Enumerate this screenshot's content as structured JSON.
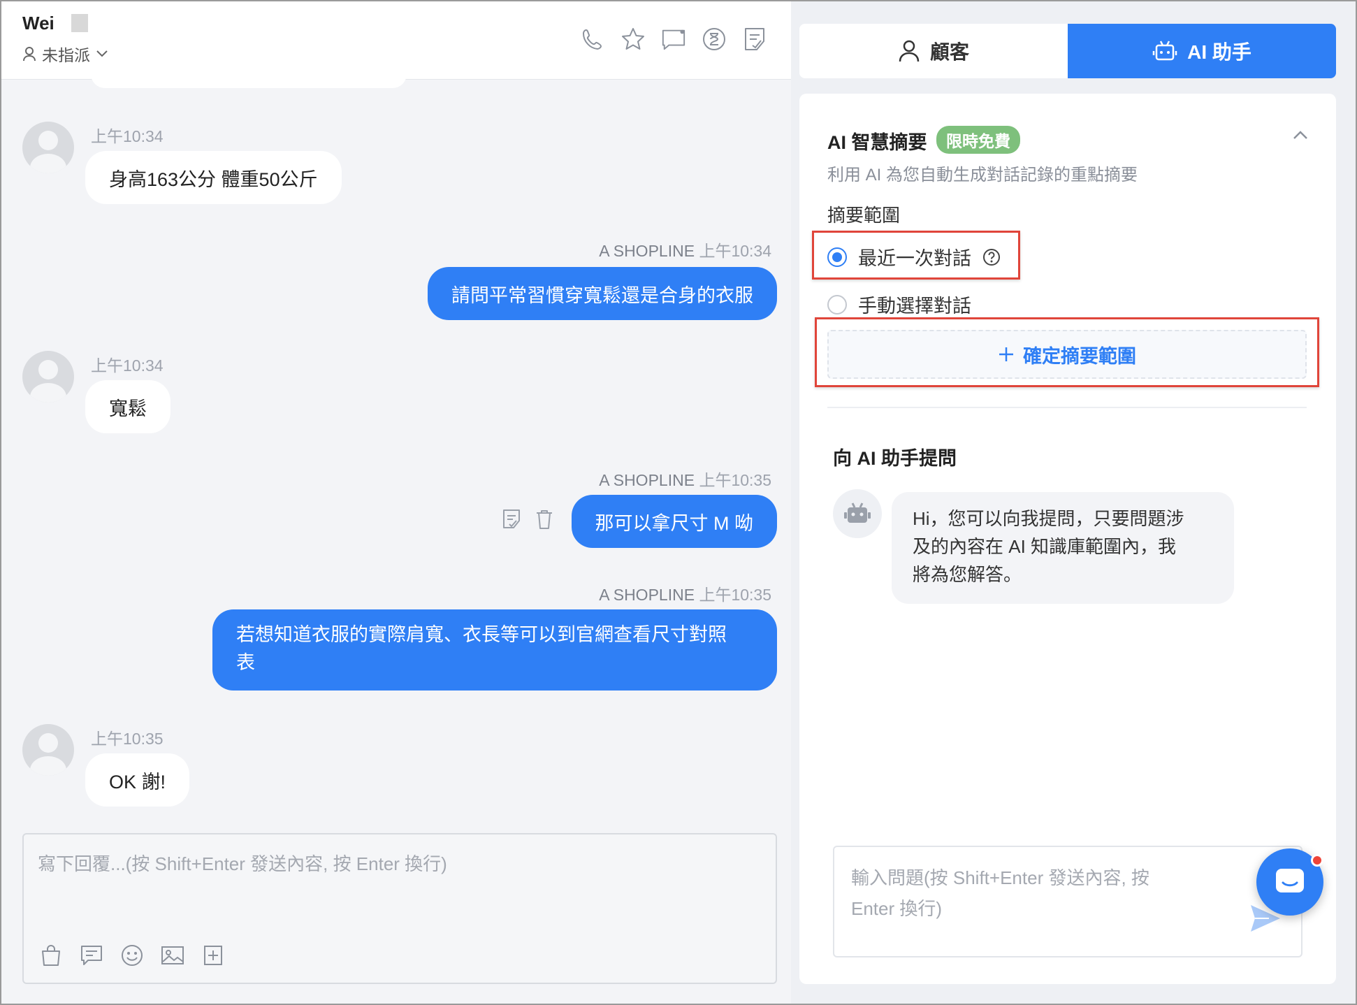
{
  "header": {
    "contact_name": "Wei",
    "assign_label": "未指派",
    "icons": [
      "phone-icon",
      "star-icon",
      "message-icon",
      "timer-icon",
      "note-icon"
    ]
  },
  "messages": [
    {
      "side": "in",
      "time": "上午10:34",
      "text": "身高163公分 體重50公斤"
    },
    {
      "side": "out",
      "agent": "A SHOPLINE",
      "time": "上午10:34",
      "text": "請問平常習慣穿寬鬆還是合身的衣服"
    },
    {
      "side": "in",
      "time": "上午10:34",
      "text": "寬鬆"
    },
    {
      "side": "out",
      "agent": "A SHOPLINE",
      "time": "上午10:35",
      "text": "那可以拿尺寸 M 呦"
    },
    {
      "side": "out",
      "agent": "A SHOPLINE",
      "time": "上午10:35",
      "text_line1": "若想知道衣服的實際肩寬、衣長等可以到官網查看尺寸對照",
      "text_line2": "表"
    },
    {
      "side": "in",
      "time": "上午10:35",
      "text": "OK 謝!"
    }
  ],
  "composer": {
    "placeholder": "寫下回覆...(按 Shift+Enter 發送內容, 按 Enter 換行)",
    "tools": [
      "shopping-bag-icon",
      "quick-reply-icon",
      "emoji-icon",
      "image-icon",
      "add-attachment-icon"
    ]
  },
  "tabs": {
    "customer": "顧客",
    "ai": "AI 助手"
  },
  "summary": {
    "title": "AI 智慧摘要",
    "badge": "限時免費",
    "description": "利用 AI 為您自動生成對話記錄的重點摘要",
    "range_label": "摘要範圍",
    "option_recent": "最近一次對話",
    "option_manual": "手動選擇對話",
    "selected": "recent",
    "confirm_label": "確定摘要範圍"
  },
  "ask": {
    "title": "向 AI 助手提問",
    "bot_message_line1": "Hi，您可以向我提問，只要問題涉",
    "bot_message_line2": "及的內容在 AI 知識庫範圍內，我",
    "bot_message_line3": "將為您解答。",
    "input_placeholder_line1": "輸入問題(按 Shift+Enter 發送內容, 按",
    "input_placeholder_line2": "Enter 換行)"
  },
  "colors": {
    "accent": "#2f7ff5",
    "badge_green": "#7ec07c",
    "highlight_red": "#e0453a"
  }
}
